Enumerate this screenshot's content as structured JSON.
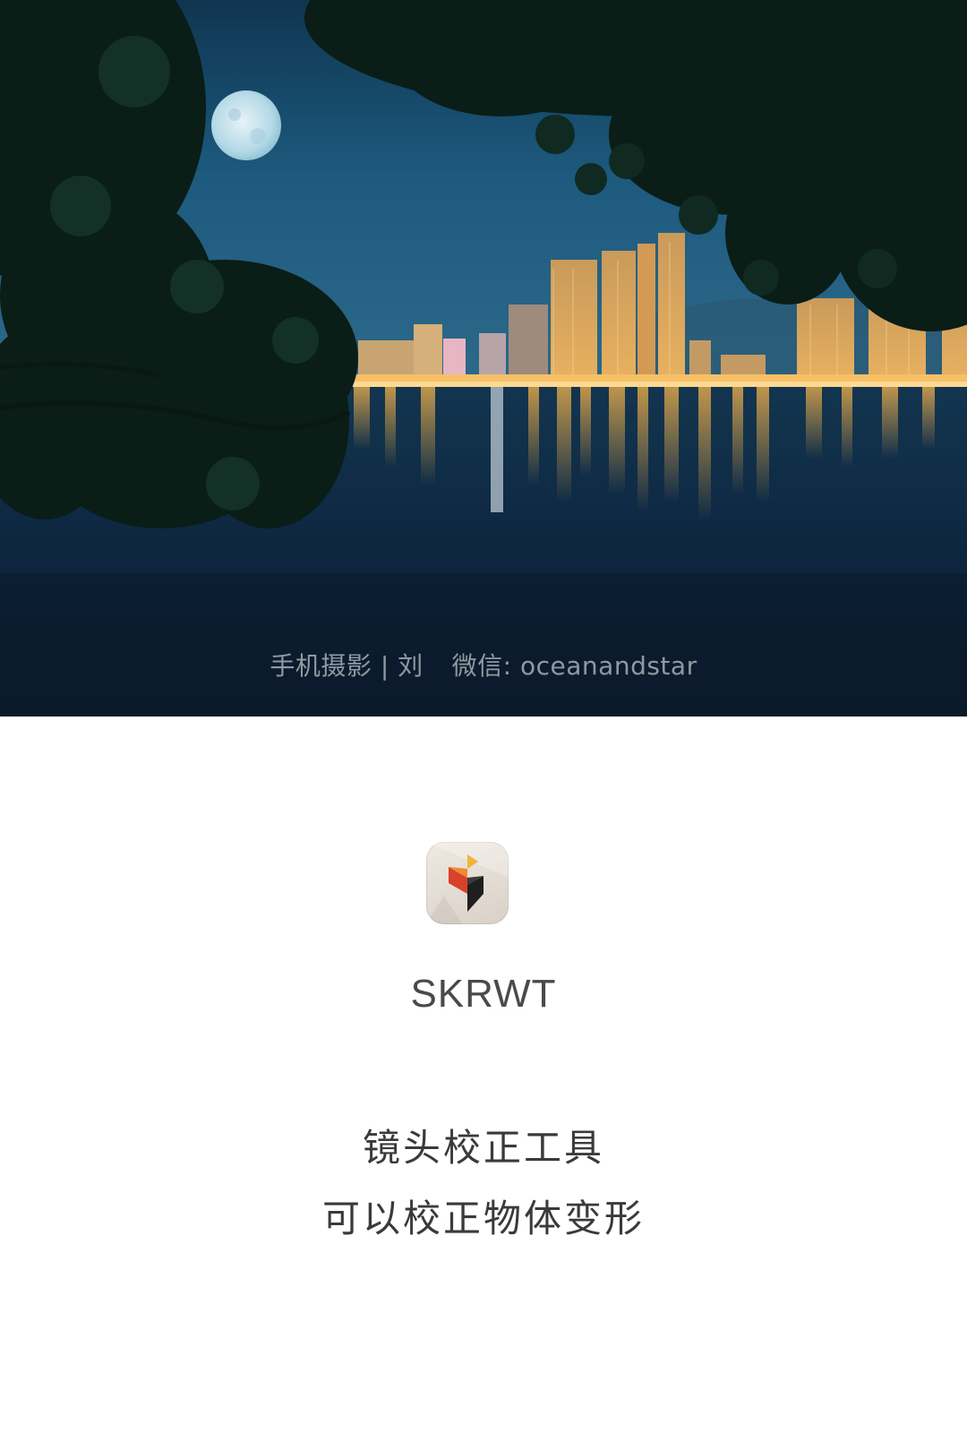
{
  "hero": {
    "watermark_left": "手机摄影 | 刘",
    "watermark_right": "微信: oceanandstar"
  },
  "app": {
    "icon_name": "skrwt-app-icon",
    "name": "SKRWT",
    "description_line1": "镜头校正工具",
    "description_line2": "可以校正物体变形"
  },
  "colors": {
    "sky_top": "#123a5a",
    "water": "#0a1f33",
    "city_lights": "#f4b24a",
    "text_dark": "#3a3a3a"
  }
}
